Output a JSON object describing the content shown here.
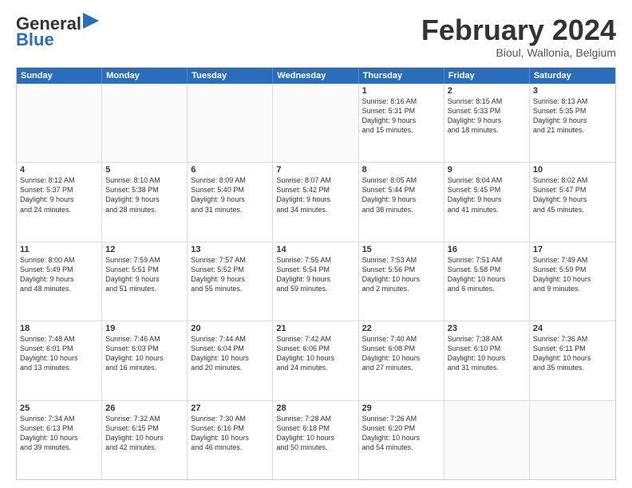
{
  "logo": {
    "text_general": "General",
    "text_blue": "Blue",
    "icon": "▶"
  },
  "header": {
    "title": "February 2024",
    "subtitle": "Bioul, Wallonia, Belgium"
  },
  "weekdays": [
    "Sunday",
    "Monday",
    "Tuesday",
    "Wednesday",
    "Thursday",
    "Friday",
    "Saturday"
  ],
  "rows": [
    [
      {
        "day": "",
        "text": ""
      },
      {
        "day": "",
        "text": ""
      },
      {
        "day": "",
        "text": ""
      },
      {
        "day": "",
        "text": ""
      },
      {
        "day": "1",
        "text": "Sunrise: 8:16 AM\nSunset: 5:31 PM\nDaylight: 9 hours\nand 15 minutes."
      },
      {
        "day": "2",
        "text": "Sunrise: 8:15 AM\nSunset: 5:33 PM\nDaylight: 9 hours\nand 18 minutes."
      },
      {
        "day": "3",
        "text": "Sunrise: 8:13 AM\nSunset: 5:35 PM\nDaylight: 9 hours\nand 21 minutes."
      }
    ],
    [
      {
        "day": "4",
        "text": "Sunrise: 8:12 AM\nSunset: 5:37 PM\nDaylight: 9 hours\nand 24 minutes."
      },
      {
        "day": "5",
        "text": "Sunrise: 8:10 AM\nSunset: 5:38 PM\nDaylight: 9 hours\nand 28 minutes."
      },
      {
        "day": "6",
        "text": "Sunrise: 8:09 AM\nSunset: 5:40 PM\nDaylight: 9 hours\nand 31 minutes."
      },
      {
        "day": "7",
        "text": "Sunrise: 8:07 AM\nSunset: 5:42 PM\nDaylight: 9 hours\nand 34 minutes."
      },
      {
        "day": "8",
        "text": "Sunrise: 8:05 AM\nSunset: 5:44 PM\nDaylight: 9 hours\nand 38 minutes."
      },
      {
        "day": "9",
        "text": "Sunrise: 8:04 AM\nSunset: 5:45 PM\nDaylight: 9 hours\nand 41 minutes."
      },
      {
        "day": "10",
        "text": "Sunrise: 8:02 AM\nSunset: 5:47 PM\nDaylight: 9 hours\nand 45 minutes."
      }
    ],
    [
      {
        "day": "11",
        "text": "Sunrise: 8:00 AM\nSunset: 5:49 PM\nDaylight: 9 hours\nand 48 minutes."
      },
      {
        "day": "12",
        "text": "Sunrise: 7:59 AM\nSunset: 5:51 PM\nDaylight: 9 hours\nand 51 minutes."
      },
      {
        "day": "13",
        "text": "Sunrise: 7:57 AM\nSunset: 5:52 PM\nDaylight: 9 hours\nand 55 minutes."
      },
      {
        "day": "14",
        "text": "Sunrise: 7:55 AM\nSunset: 5:54 PM\nDaylight: 9 hours\nand 59 minutes."
      },
      {
        "day": "15",
        "text": "Sunrise: 7:53 AM\nSunset: 5:56 PM\nDaylight: 10 hours\nand 2 minutes."
      },
      {
        "day": "16",
        "text": "Sunrise: 7:51 AM\nSunset: 5:58 PM\nDaylight: 10 hours\nand 6 minutes."
      },
      {
        "day": "17",
        "text": "Sunrise: 7:49 AM\nSunset: 5:59 PM\nDaylight: 10 hours\nand 9 minutes."
      }
    ],
    [
      {
        "day": "18",
        "text": "Sunrise: 7:48 AM\nSunset: 6:01 PM\nDaylight: 10 hours\nand 13 minutes."
      },
      {
        "day": "19",
        "text": "Sunrise: 7:46 AM\nSunset: 6:03 PM\nDaylight: 10 hours\nand 16 minutes."
      },
      {
        "day": "20",
        "text": "Sunrise: 7:44 AM\nSunset: 6:04 PM\nDaylight: 10 hours\nand 20 minutes."
      },
      {
        "day": "21",
        "text": "Sunrise: 7:42 AM\nSunset: 6:06 PM\nDaylight: 10 hours\nand 24 minutes."
      },
      {
        "day": "22",
        "text": "Sunrise: 7:40 AM\nSunset: 6:08 PM\nDaylight: 10 hours\nand 27 minutes."
      },
      {
        "day": "23",
        "text": "Sunrise: 7:38 AM\nSunset: 6:10 PM\nDaylight: 10 hours\nand 31 minutes."
      },
      {
        "day": "24",
        "text": "Sunrise: 7:36 AM\nSunset: 6:11 PM\nDaylight: 10 hours\nand 35 minutes."
      }
    ],
    [
      {
        "day": "25",
        "text": "Sunrise: 7:34 AM\nSunset: 6:13 PM\nDaylight: 10 hours\nand 39 minutes."
      },
      {
        "day": "26",
        "text": "Sunrise: 7:32 AM\nSunset: 6:15 PM\nDaylight: 10 hours\nand 42 minutes."
      },
      {
        "day": "27",
        "text": "Sunrise: 7:30 AM\nSunset: 6:16 PM\nDaylight: 10 hours\nand 46 minutes."
      },
      {
        "day": "28",
        "text": "Sunrise: 7:28 AM\nSunset: 6:18 PM\nDaylight: 10 hours\nand 50 minutes."
      },
      {
        "day": "29",
        "text": "Sunrise: 7:26 AM\nSunset: 6:20 PM\nDaylight: 10 hours\nand 54 minutes."
      },
      {
        "day": "",
        "text": ""
      },
      {
        "day": "",
        "text": ""
      }
    ]
  ]
}
